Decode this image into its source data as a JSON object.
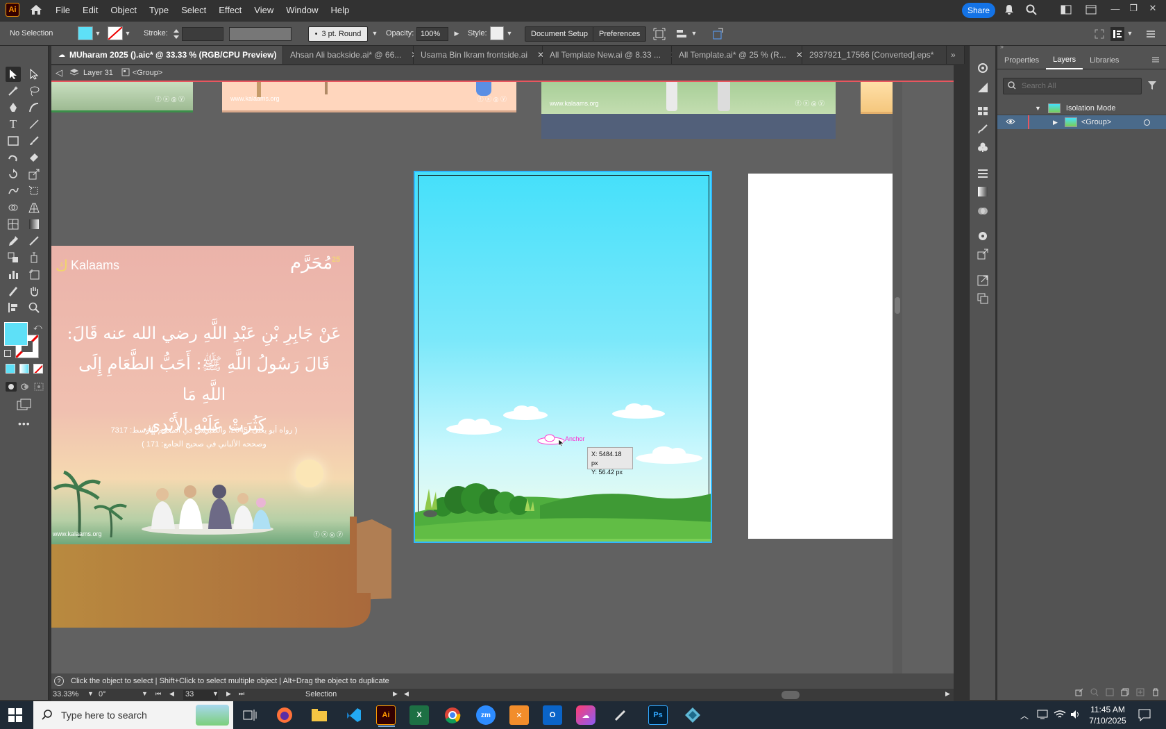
{
  "menubar": {
    "app_logo": "Ai",
    "items": [
      "File",
      "Edit",
      "Object",
      "Type",
      "Select",
      "Effect",
      "View",
      "Window",
      "Help"
    ],
    "share_label": "Share"
  },
  "controlbar": {
    "selection_status": "No Selection",
    "fill_color": "#5ee0f7",
    "stroke_label": "Stroke:",
    "brush_label": "3 pt. Round",
    "opacity_label": "Opacity:",
    "opacity_value": "100%",
    "style_label": "Style:",
    "document_setup_label": "Document Setup",
    "preferences_label": "Preferences"
  },
  "tabs": [
    {
      "label": "MUharam 2025 ().aic* @ 33.33 % (RGB/CPU Preview)",
      "active": true
    },
    {
      "label": "Ahsan Ali backside.ai* @ 66...",
      "active": false
    },
    {
      "label": "Usama Bin Ikram frontside.ai",
      "active": false
    },
    {
      "label": "All Template New.ai @ 8.33 ...",
      "active": false
    },
    {
      "label": "All Template.ai* @ 25 % (R...",
      "active": false
    },
    {
      "label": "2937921_17566 [Converted].eps*",
      "active": false
    }
  ],
  "breadcrumb": {
    "layer": "Layer 31",
    "group": "<Group>"
  },
  "canvas": {
    "website_text": "www.kalaams.org",
    "brand_name": "Kalaams",
    "anchor_label": "Anchor",
    "cursor_readout": {
      "x": "X: 5484.18 px",
      "y": "Y: 56.42 px"
    },
    "hadith_line1": "عَنْ جَابِرِ بْنِ عَبْدِ اللَّهِ رضي الله عنه قَالَ:",
    "hadith_line2": "قَالَ رَسُولُ اللَّهِ ﷺ: أَحَبُّ الطَّعَامِ إِلَى اللَّهِ مَا",
    "hadith_line3": "كَثُرَتْ عَلَيْهِ الأَيْدِي.",
    "reference_line1": "( رواه أبو يعلى: 2045، والطبراني في المعجم الأوسط: 7317",
    "reference_line2": "وصححه الألباني في صحيح الجامع: 171 )",
    "muharram_text": "مُحَرَّم",
    "year_badge": "25"
  },
  "status": {
    "hint": "Click the object to select  |  Shift+Click to select multiple object  |  Alt+Drag the object to duplicate",
    "zoom": "33.33%",
    "rotation": "0°",
    "artboard_number": "33",
    "tool_name": "Selection"
  },
  "panel": {
    "tabs": [
      "Properties",
      "Layers",
      "Libraries"
    ],
    "active_tab": "Layers",
    "search_placeholder": "Search All",
    "isolation_mode_label": "Isolation Mode",
    "group_label": "<Group>"
  },
  "taskbar": {
    "search_placeholder": "Type here to search",
    "time": "11:45 AM",
    "date": "7/10/2025"
  }
}
